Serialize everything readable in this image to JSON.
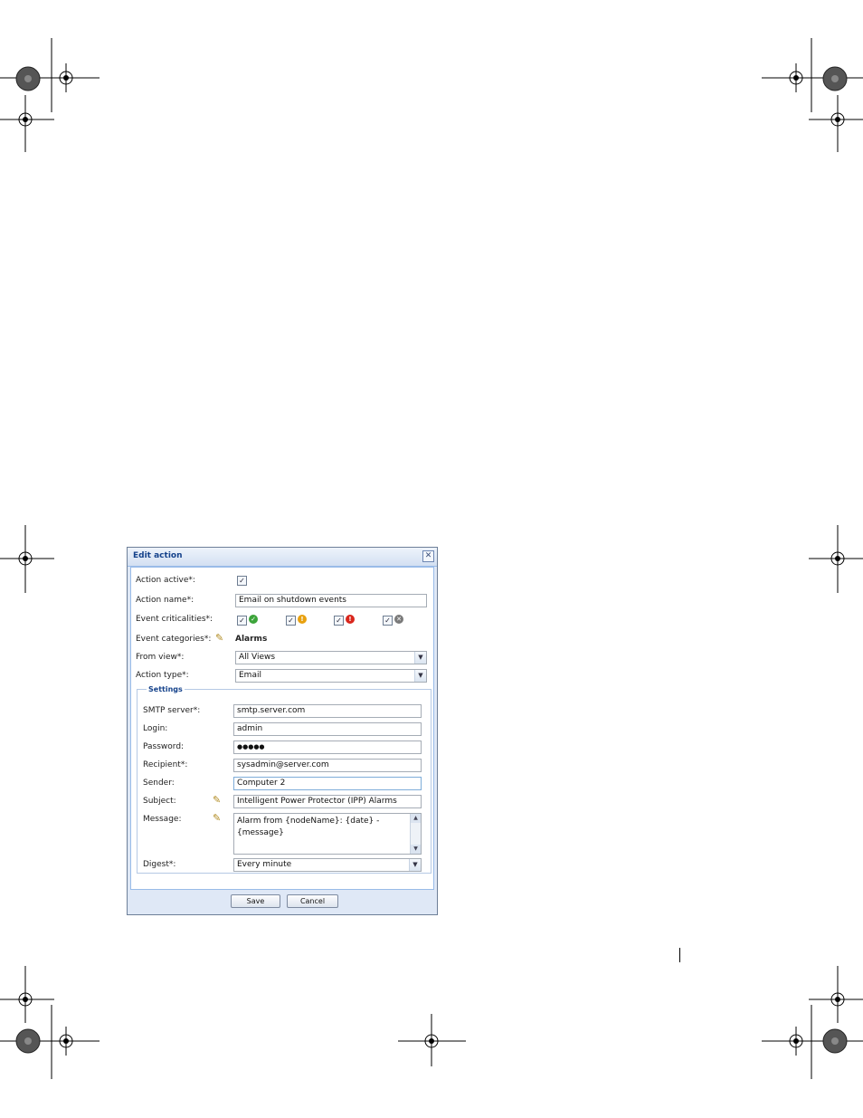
{
  "dialog": {
    "title": "Edit action",
    "close_glyph": "✕",
    "fields": {
      "action_active_label": "Action active*:",
      "action_name_label": "Action name*:",
      "action_name_value": "Email on shutdown events",
      "event_criticalities_label": "Event criticalities*:",
      "event_categories_label": "Event categories*:",
      "event_categories_value": "Alarms",
      "from_view_label": "From view*:",
      "from_view_value": "All Views",
      "action_type_label": "Action type*:",
      "action_type_value": "Email"
    },
    "criticalities": [
      {
        "icon": "ok-icon",
        "glyph": "✓",
        "color": "#3ca43a",
        "checked": true
      },
      {
        "icon": "warning-icon",
        "glyph": "!",
        "color": "#e8a10f",
        "checked": true
      },
      {
        "icon": "critical-icon",
        "glyph": "!",
        "color": "#d9261c",
        "checked": true
      },
      {
        "icon": "unknown-icon",
        "glyph": "✕",
        "color": "#7a7a7a",
        "checked": true
      }
    ],
    "settings": {
      "legend": "Settings",
      "smtp_label": "SMTP server*:",
      "smtp_value": "smtp.server.com",
      "login_label": "Login:",
      "login_value": "admin",
      "password_label": "Password:",
      "password_value": "●●●●●",
      "recipient_label": "Recipient*:",
      "recipient_value": "sysadmin@server.com",
      "sender_label": "Sender:",
      "sender_value": "Computer 2",
      "subject_label": "Subject:",
      "subject_value": "Intelligent Power Protector (IPP) Alarms",
      "message_label": "Message:",
      "message_value": "Alarm from {nodeName}: {date} - {message}",
      "digest_label": "Digest*:",
      "digest_value": "Every minute"
    },
    "buttons": {
      "save": "Save",
      "cancel": "Cancel"
    },
    "checkbox_glyph": "✓",
    "dropdown_glyph": "▼",
    "scroll_up_glyph": "▲",
    "scroll_down_glyph": "▼",
    "pencil_glyph": "✎"
  }
}
